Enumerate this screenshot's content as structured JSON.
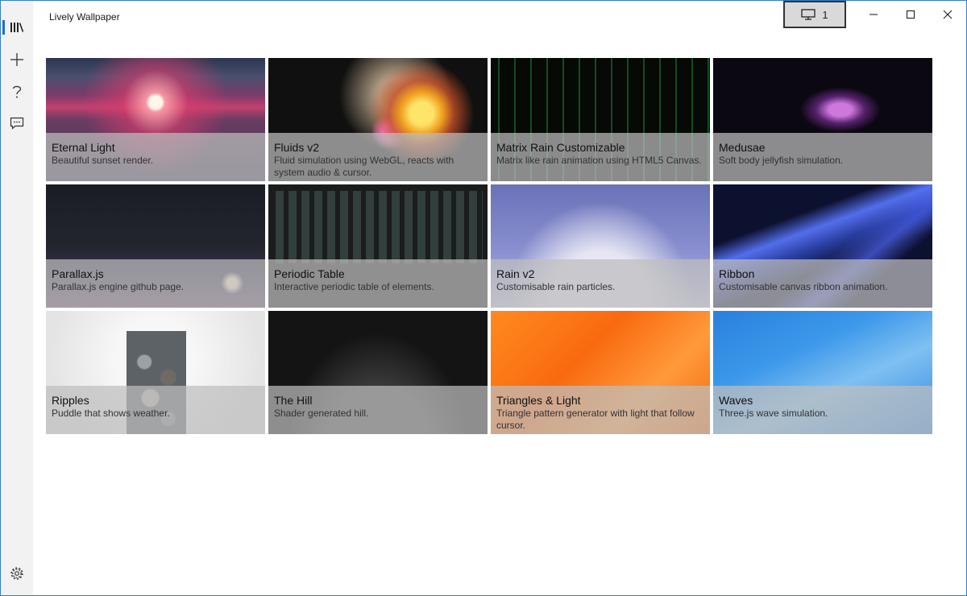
{
  "app": {
    "title": "Lively Wallpaper"
  },
  "titlebar": {
    "screen_label": "1"
  },
  "nav": {
    "items": [
      {
        "name": "library",
        "icon": "library-icon"
      },
      {
        "name": "add",
        "icon": "plus-icon"
      },
      {
        "name": "help",
        "icon": "help-icon"
      },
      {
        "name": "feedback",
        "icon": "feedback-icon"
      }
    ],
    "settings_icon": "gear-icon"
  },
  "colors": {
    "accent": "#1a72d6",
    "nav_bg": "#f2f2f2",
    "window_border": "#2f7fcf"
  },
  "library": {
    "selected_index": 4,
    "tiles": [
      {
        "title": "Eternal Light",
        "desc": "Beautiful sunset render."
      },
      {
        "title": "Fluids v2",
        "desc": "Fluid simulation using WebGL, reacts with system audio & cursor."
      },
      {
        "title": "Matrix Rain Customizable",
        "desc": "Matrix like rain animation using HTML5 Canvas."
      },
      {
        "title": "Medusae",
        "desc": "Soft body jellyfish simulation."
      },
      {
        "title": "Parallax.js",
        "desc": "Parallax.js engine github page."
      },
      {
        "title": "Periodic Table",
        "desc": "Interactive periodic table of elements."
      },
      {
        "title": "Rain v2",
        "desc": "Customisable rain particles."
      },
      {
        "title": "Ribbon",
        "desc": "Customisable canvas ribbon animation."
      },
      {
        "title": "Ripples",
        "desc": "Puddle that shows weather."
      },
      {
        "title": "The Hill",
        "desc": "Shader generated hill."
      },
      {
        "title": "Triangles & Light",
        "desc": "Triangle pattern generator with light that follow cursor."
      },
      {
        "title": "Waves",
        "desc": "Three.js wave simulation."
      }
    ]
  }
}
